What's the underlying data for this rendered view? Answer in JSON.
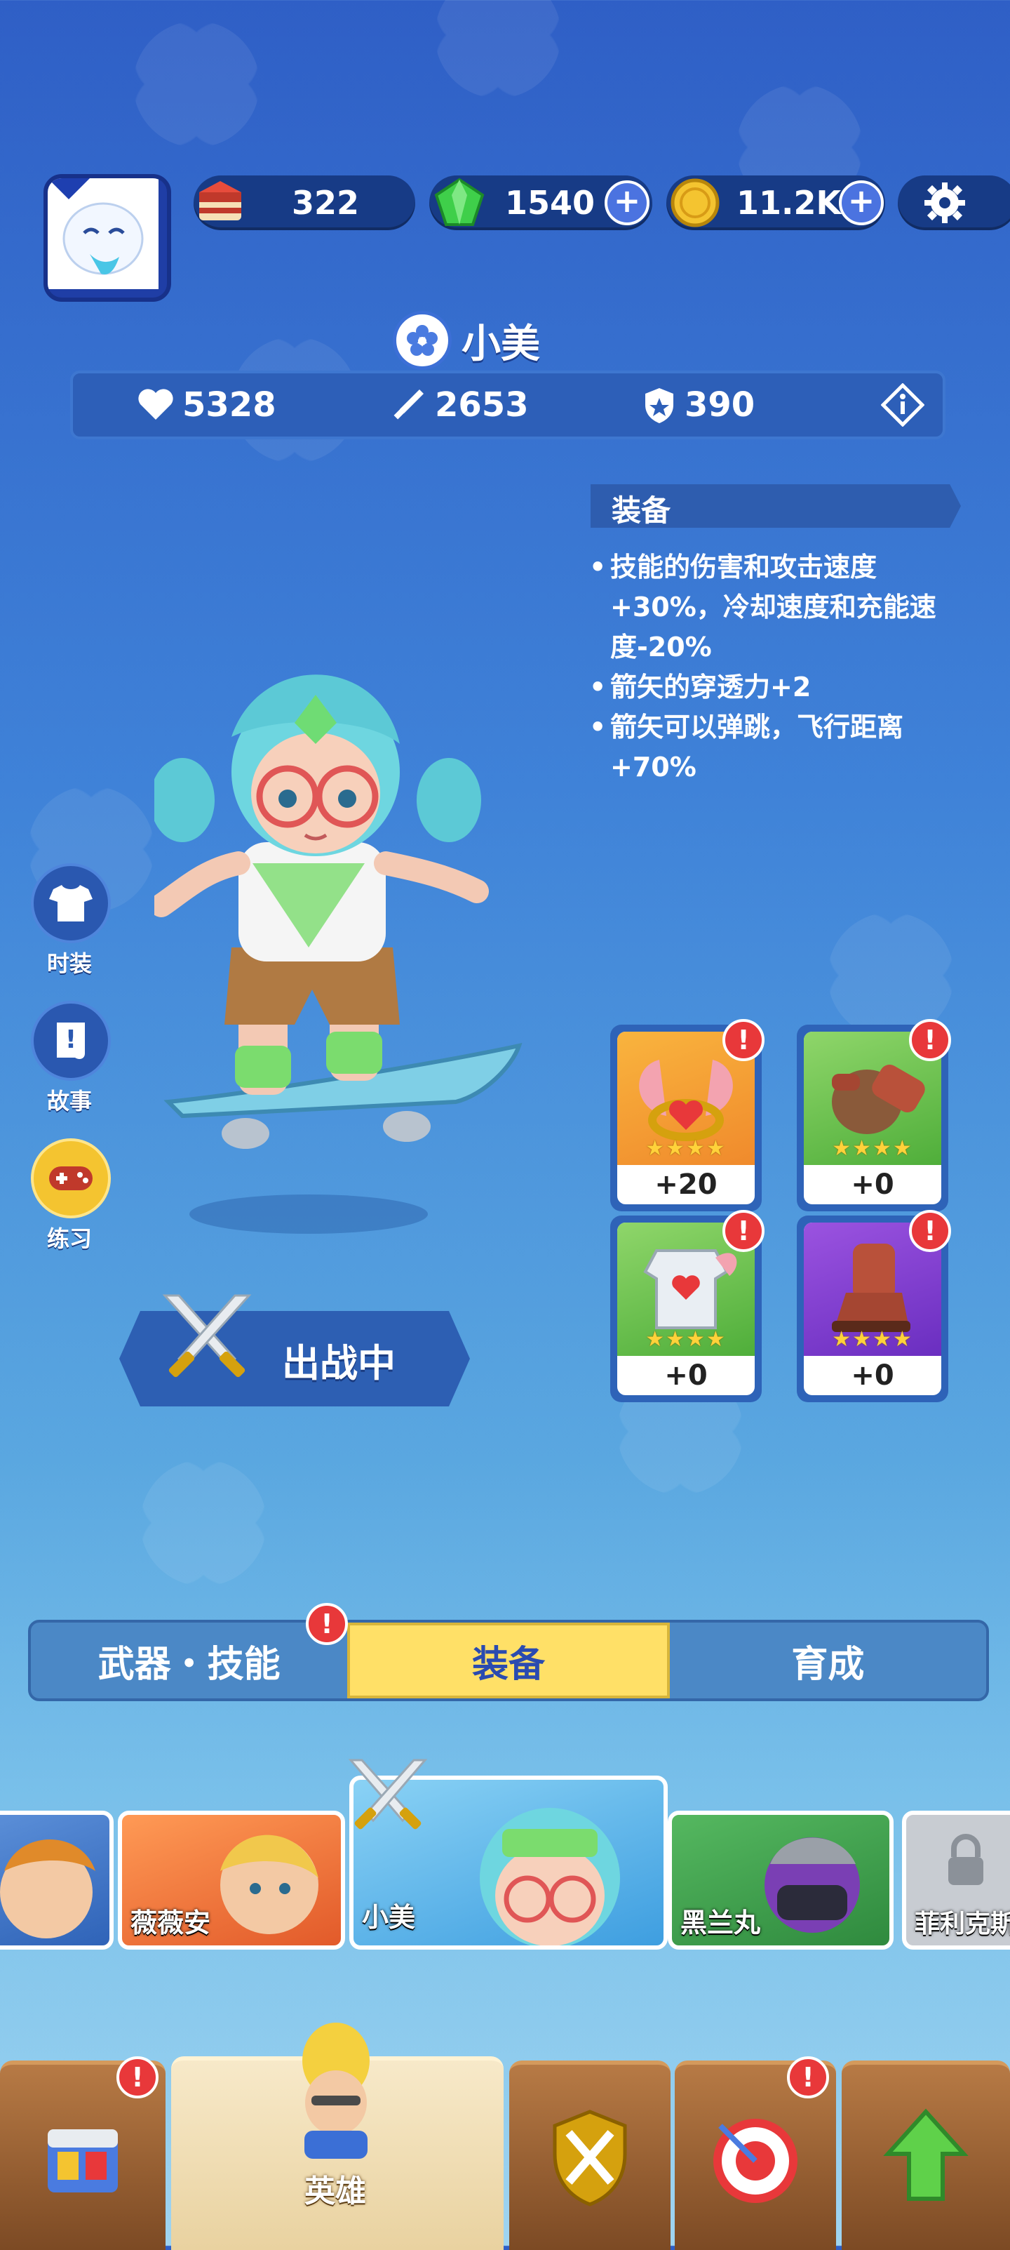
{
  "currencies": {
    "cake": "322",
    "gems": "1540",
    "coins": "11.2K"
  },
  "hero": {
    "name": "小美",
    "health": "5328",
    "attack": "2653",
    "defense": "390"
  },
  "equipment": {
    "title": "装备",
    "lines": [
      "技能的伤害和攻击速度",
      "+30%，冷却速度和充能速",
      "度-20%",
      "箭矢的穿透力+2",
      "箭矢可以弹跳，飞行距离",
      "+70%"
    ],
    "items": [
      {
        "icon": "winged-ring-icon",
        "level": "+20",
        "stars": "★★★★"
      },
      {
        "icon": "gauntlet-icon",
        "level": "+0",
        "stars": "★★★★"
      },
      {
        "icon": "armor-icon",
        "level": "+0",
        "stars": "★★★★"
      },
      {
        "icon": "boots-icon",
        "level": "+0",
        "stars": "★★★★"
      }
    ]
  },
  "side_menu": {
    "costume": "时装",
    "story": "故事",
    "practice": "练习"
  },
  "battle_label": "出战中",
  "tabs": {
    "weapons_skills": "武器・技能",
    "equipment": "装备",
    "training": "育成"
  },
  "heroes": [
    {
      "name": ""
    },
    {
      "name": "薇薇安"
    },
    {
      "name": "小美"
    },
    {
      "name": "黑兰丸"
    },
    {
      "name": "菲利克斯"
    }
  ],
  "nav": {
    "hero_label": "英雄"
  },
  "colors": {
    "tab_active": "#ffe067",
    "alert": "#e8383a",
    "star": "#ffd23a"
  }
}
